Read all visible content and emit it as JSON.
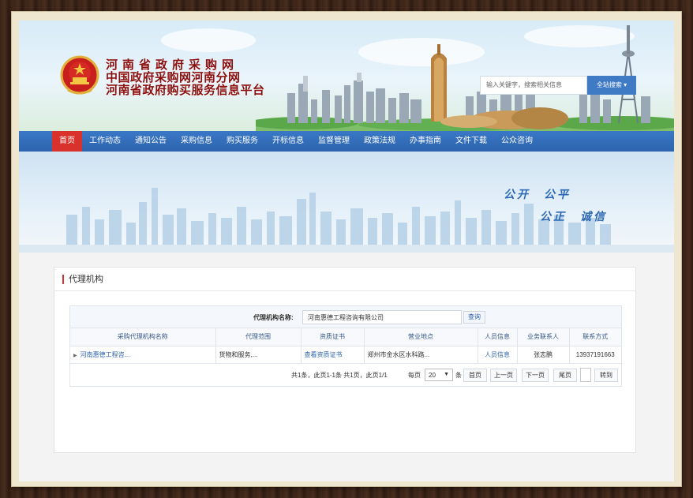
{
  "site": {
    "titles": [
      "河南省政府采购网",
      "中国政府采购网河南分网",
      "河南省政府购买服务信息平台"
    ]
  },
  "search": {
    "placeholder": "输入关键字，搜索相关信息",
    "button_label": "全站搜索"
  },
  "nav": {
    "items": [
      "首页",
      "工作动态",
      "通知公告",
      "采购信息",
      "购买服务",
      "开标信息",
      "监督管理",
      "政策法规",
      "办事指南",
      "文件下载",
      "公众咨询"
    ],
    "active_index": 0
  },
  "banner": {
    "slogan_line1": "公开　公平",
    "slogan_line2": "公正　诚信"
  },
  "panel": {
    "title": "代理机构"
  },
  "filter": {
    "label": "代理机构名称:",
    "value": "河南惠德工程咨询有限公司",
    "button_label": "查询"
  },
  "table": {
    "columns": [
      "采购代理机构名称",
      "代理范围",
      "资质证书",
      "营业地点",
      "人员信息",
      "业务联系人",
      "联系方式"
    ],
    "rows": [
      {
        "name": "河南惠德工程咨...",
        "scope": "货物和服务,...",
        "certificate": "查看资质证书",
        "location": "郑州市金水区水科路...",
        "staff": "人员信息",
        "contact": "张志鹏",
        "phone": "13937191663"
      }
    ]
  },
  "pager": {
    "info": "共1条，此页1-1条 共1页，此页1/1",
    "per_page_label": "每页",
    "per_page_value": "20",
    "unit": "条",
    "first": "首页",
    "prev": "上一页",
    "next": "下一页",
    "last": "尾页",
    "go": "转到"
  },
  "colors": {
    "nav_blue": "#2d64ad",
    "active_red": "#d9322c",
    "title_red": "#8a1010"
  }
}
